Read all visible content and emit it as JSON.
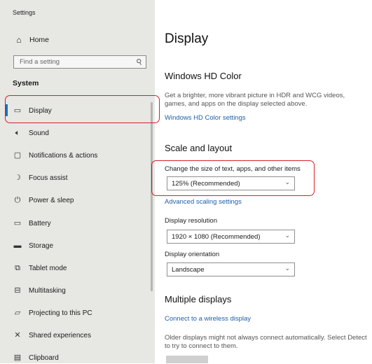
{
  "window": {
    "title": "Settings"
  },
  "sidebar": {
    "home": {
      "label": "Home",
      "icon": "home-icon"
    },
    "search": {
      "placeholder": "Find a setting"
    },
    "section": "System",
    "items": [
      {
        "label": "Display",
        "icon": "monitor-icon",
        "selected": true
      },
      {
        "label": "Sound",
        "icon": "speaker-icon"
      },
      {
        "label": "Notifications & actions",
        "icon": "notification-icon"
      },
      {
        "label": "Focus assist",
        "icon": "moon-icon"
      },
      {
        "label": "Power & sleep",
        "icon": "power-icon"
      },
      {
        "label": "Battery",
        "icon": "battery-icon"
      },
      {
        "label": "Storage",
        "icon": "storage-icon"
      },
      {
        "label": "Tablet mode",
        "icon": "tablet-icon"
      },
      {
        "label": "Multitasking",
        "icon": "multitasking-icon"
      },
      {
        "label": "Projecting to this PC",
        "icon": "projector-icon"
      },
      {
        "label": "Shared experiences",
        "icon": "shared-icon"
      },
      {
        "label": "Clipboard",
        "icon": "clipboard-icon"
      }
    ]
  },
  "main": {
    "title": "Display",
    "hd_color": {
      "heading": "Windows HD Color",
      "description": "Get a brighter, more vibrant picture in HDR and WCG videos, games, and apps on the display selected above.",
      "link": "Windows HD Color settings"
    },
    "scale": {
      "heading": "Scale and layout",
      "size_label": "Change the size of text, apps, and other items",
      "size_value": "125% (Recommended)",
      "advanced_link": "Advanced scaling settings",
      "resolution_label": "Display resolution",
      "resolution_value": "1920 × 1080 (Recommended)",
      "orientation_label": "Display orientation",
      "orientation_value": "Landscape"
    },
    "multiple": {
      "heading": "Multiple displays",
      "link": "Connect to a wireless display",
      "description": "Older displays might not always connect automatically. Select Detect to try to connect to them."
    }
  },
  "colors": {
    "accent": "#1a6fb5",
    "link": "#1f5fa8",
    "highlight": "#d6202a",
    "sidebar_bg": "#e7e7e4"
  }
}
